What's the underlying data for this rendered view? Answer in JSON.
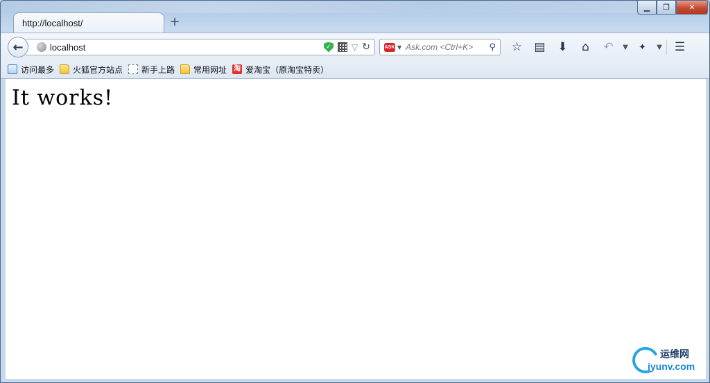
{
  "tab": {
    "title": "http://localhost/",
    "new_tab_symbol": "+"
  },
  "window_controls": {
    "minimize": "▁",
    "maximize": "❐",
    "close": "✕"
  },
  "navbar": {
    "url": "localhost",
    "search_placeholder": "Ask.com <Ctrl+K>",
    "search_engine_logo": "ASK",
    "icons": [
      "back-arrow-icon",
      "globe-icon",
      "security-shield-icon",
      "qr-code-icon",
      "dropdown-icon",
      "reload-icon",
      "ask-logo-icon",
      "search-icon",
      "star-icon",
      "reading-list-icon",
      "download-icon",
      "home-icon",
      "undo-icon",
      "extension-icon",
      "menu-icon"
    ]
  },
  "bookmarks": [
    {
      "label": "访问最多",
      "icon": "most-visited-icon"
    },
    {
      "label": "火狐官方站点",
      "icon": "folder-icon"
    },
    {
      "label": "新手上路",
      "icon": "dashed-page-icon"
    },
    {
      "label": "常用网址",
      "icon": "folder-icon"
    },
    {
      "label": "爱淘宝（原淘宝特卖）",
      "icon": "taobao-icon",
      "icon_char": "淘"
    }
  ],
  "content": {
    "heading": "It works!"
  },
  "watermark": {
    "top": "运维网",
    "bottom": "iyunv.com"
  },
  "colors": {
    "accent": "#27a4e3",
    "close_button": "#c44b33",
    "shield": "#35b34a"
  }
}
